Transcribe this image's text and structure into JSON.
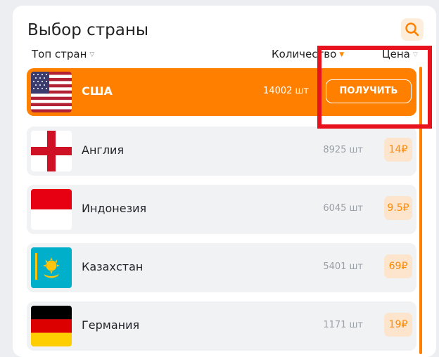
{
  "page": {
    "title": "Выбор страны",
    "search_icon": "search-icon"
  },
  "columns": {
    "top": "Топ стран",
    "quantity": "Количество",
    "price": "Цена"
  },
  "countries": [
    {
      "name": "США",
      "quantity": "14002 шт",
      "action": "ПОЛУЧИТЬ",
      "flag": "usa-flag-icon",
      "selected": true
    },
    {
      "name": "Англия",
      "quantity": "8925 шт",
      "price": "14₽",
      "flag": "england-flag-icon"
    },
    {
      "name": "Индонезия",
      "quantity": "6045 шт",
      "price": "9.5₽",
      "flag": "indonesia-flag-icon"
    },
    {
      "name": "Казахстан",
      "quantity": "5401 шт",
      "price": "69₽",
      "flag": "kazakhstan-flag-icon"
    },
    {
      "name": "Германия",
      "quantity": "1171 шт",
      "price": "19₽",
      "flag": "germany-flag-icon"
    }
  ],
  "colors": {
    "accent": "#ff8000",
    "highlight": "#e8121f",
    "price_bg": "#fde4cc"
  }
}
